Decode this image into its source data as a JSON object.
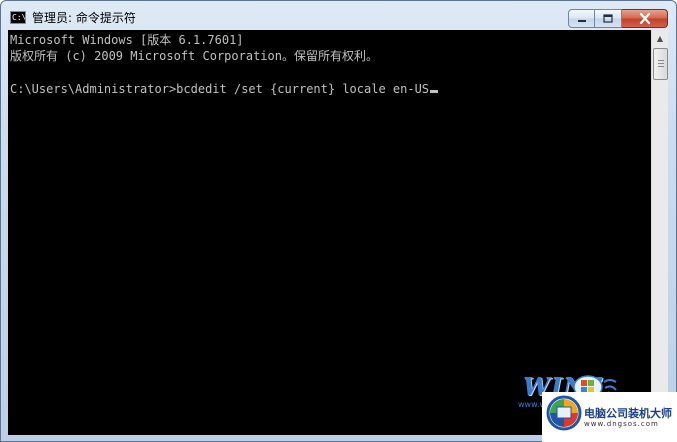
{
  "window": {
    "title": "管理员: 命令提示符",
    "icon_label": "C:\\"
  },
  "console": {
    "lines": [
      "Microsoft Windows [版本 6.1.7601]",
      "版权所有 (c) 2009 Microsoft Corporation。保留所有权利。",
      "",
      "C:\\Users\\Administrator>bcdedit /set {current} locale en-US"
    ]
  },
  "watermark": {
    "logo_text": "WIN7",
    "url": "www.win7",
    "brand_name": "电脑公司装机大师",
    "brand_domain": "www.dngsos.com"
  },
  "icons": {
    "app": "cmd-icon",
    "minimize": "minimize-icon",
    "maximize": "maximize-icon",
    "close": "close-icon"
  },
  "colors": {
    "console_bg": "#000000",
    "console_text": "#c0c0c0",
    "close_button": "#c4412a"
  }
}
